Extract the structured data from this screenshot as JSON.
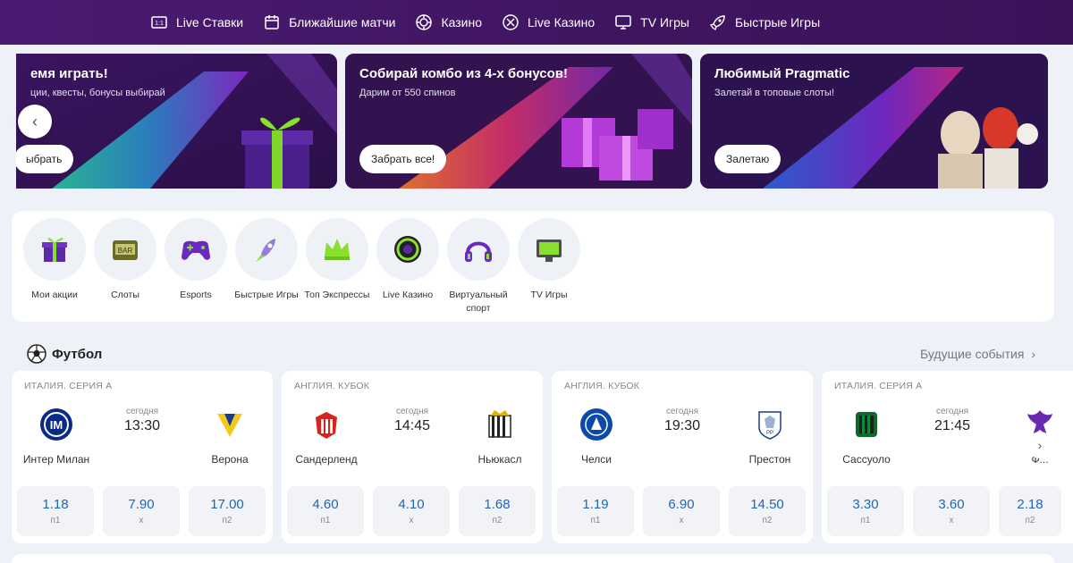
{
  "nav": [
    {
      "label": "Live Ставки",
      "icon": "live-bets-icon"
    },
    {
      "label": "Ближайшие матчи",
      "icon": "calendar-icon"
    },
    {
      "label": "Казино",
      "icon": "casino-chip-icon"
    },
    {
      "label": "Live Казино",
      "icon": "live-casino-icon"
    },
    {
      "label": "TV Игры",
      "icon": "tv-icon"
    },
    {
      "label": "Быстрые Игры",
      "icon": "rocket-icon"
    }
  ],
  "banners": [
    {
      "title": "емя играть!",
      "subtitle": "ции, квесты, бонусы выбирай",
      "button": "ыбрать"
    },
    {
      "title": "Собирай комбо из 4-х бонусов!",
      "subtitle": "Дарим от 550 спинов",
      "button": "Забрать все!"
    },
    {
      "title": "Любимый Pragmatic",
      "subtitle": "Залетай в топовые слоты!",
      "button": "Залетаю"
    }
  ],
  "categories": [
    {
      "label": "Мои акции",
      "icon": "gift-icon"
    },
    {
      "label": "Слоты",
      "icon": "slot-machine-icon"
    },
    {
      "label": "Esports",
      "icon": "gamepad-icon"
    },
    {
      "label": "Быстрые Игры",
      "icon": "rocket-icon"
    },
    {
      "label": "Топ Экспрессы",
      "icon": "crown-icon"
    },
    {
      "label": "Live Казино",
      "icon": "live-casino-icon"
    },
    {
      "label": "Виртуальный спорт",
      "icon": "headphones-icon"
    },
    {
      "label": "TV Игры",
      "icon": "tv-icon"
    }
  ],
  "section": {
    "title": "Футбол",
    "future_link": "Будущие события"
  },
  "matches": [
    {
      "league": "ИТАЛИЯ. СЕРИЯ А",
      "home": "Интер Милан",
      "away": "Верона",
      "day": "сегодня",
      "time": "13:30",
      "odds": [
        {
          "v": "1.18",
          "l": "п1"
        },
        {
          "v": "7.90",
          "l": "х"
        },
        {
          "v": "17.00",
          "l": "п2"
        }
      ]
    },
    {
      "league": "АНГЛИЯ. КУБОК",
      "home": "Сандерленд",
      "away": "Ньюкасл",
      "day": "сегодня",
      "time": "14:45",
      "odds": [
        {
          "v": "4.60",
          "l": "п1"
        },
        {
          "v": "4.10",
          "l": "х"
        },
        {
          "v": "1.68",
          "l": "п2"
        }
      ]
    },
    {
      "league": "АНГЛИЯ. КУБОК",
      "home": "Челси",
      "away": "Престон",
      "day": "сегодня",
      "time": "19:30",
      "odds": [
        {
          "v": "1.19",
          "l": "п1"
        },
        {
          "v": "6.90",
          "l": "х"
        },
        {
          "v": "14.50",
          "l": "п2"
        }
      ]
    },
    {
      "league": "ИТАЛИЯ. СЕРИЯ А",
      "home": "Сассуоло",
      "away": "Ф...",
      "day": "сегодня",
      "time": "21:45",
      "odds": [
        {
          "v": "3.30",
          "l": "п1"
        },
        {
          "v": "3.60",
          "l": "х"
        },
        {
          "v": "2.18",
          "l": "п2"
        }
      ]
    }
  ],
  "colors": {
    "nav_bg": "#4a1b72",
    "odds_text": "#1f66b3",
    "page_bg": "#eef1f7"
  }
}
